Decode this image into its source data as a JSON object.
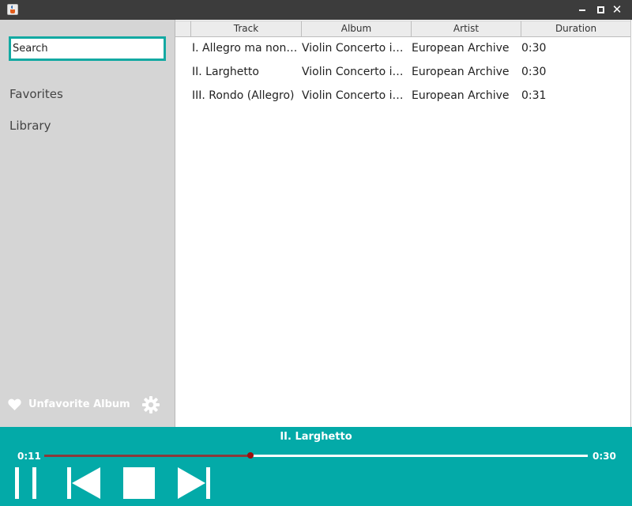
{
  "window": {
    "title": ""
  },
  "sidebar": {
    "search_placeholder": "Search",
    "items": [
      {
        "label": "Favorites"
      },
      {
        "label": "Library"
      }
    ],
    "unfavorite_label": "Unfavorite Album"
  },
  "table": {
    "headers": [
      "Track",
      "Album",
      "Artist",
      "Duration"
    ],
    "rows": [
      {
        "track": "I. Allegro ma non troppo",
        "album": "Violin Concerto in D major",
        "artist": "European Archive",
        "duration": "0:30"
      },
      {
        "track": "II. Larghetto",
        "album": "Violin Concerto in D major",
        "artist": "European Archive",
        "duration": "0:30"
      },
      {
        "track": "III. Rondo (Allegro)",
        "album": "Violin Concerto in D major",
        "artist": "European Archive",
        "duration": "0:31"
      }
    ]
  },
  "player": {
    "now_playing": "II. Larghetto",
    "elapsed": "0:11",
    "total": "0:30",
    "progress": 0.38
  },
  "icons": {
    "favorite": "heart-icon",
    "settings": "gear-icon",
    "pause": "pause-icon",
    "previous": "skip-previous-icon",
    "stop": "stop-icon",
    "next": "skip-next-icon"
  },
  "colors": {
    "accent": "#03aaa8",
    "sidebar_bg": "#d5d5d5",
    "seek_knob": "#9b0f0f"
  }
}
